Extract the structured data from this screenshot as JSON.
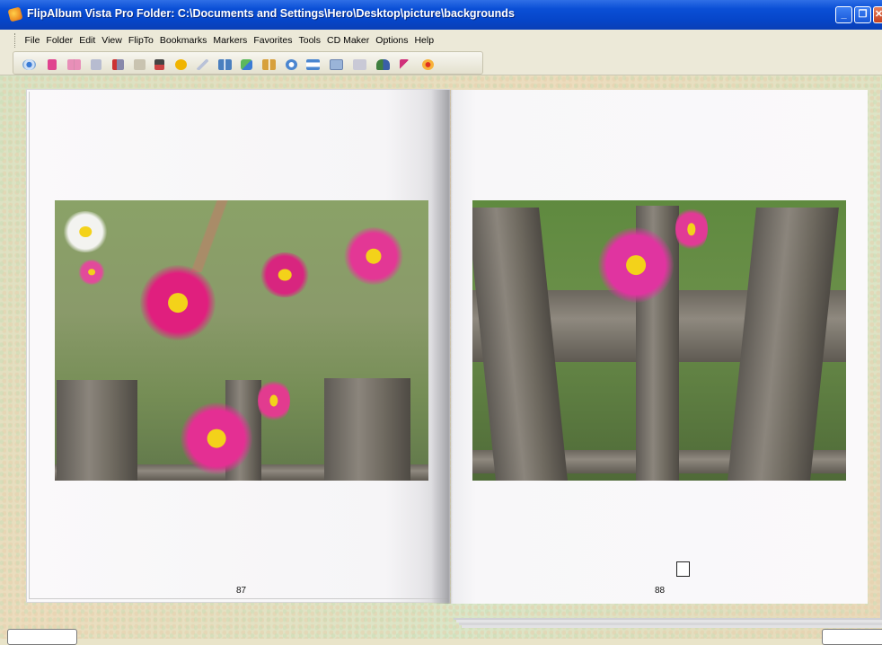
{
  "window": {
    "title": "FlipAlbum Vista Pro    Folder: C:\\Documents and Settings\\Hero\\Desktop\\picture\\backgrounds"
  },
  "menu": {
    "items": [
      "File",
      "Folder",
      "Edit",
      "View",
      "FlipTo",
      "Bookmarks",
      "Markers",
      "Favorites",
      "Tools",
      "CD Maker",
      "Options",
      "Help"
    ]
  },
  "toolbar": {
    "icons": [
      "eye-icon",
      "pink-page-icon",
      "open-book-icon",
      "single-page-icon",
      "page-arrow-icon",
      "page-list-icon",
      "save-page-icon",
      "add-circle-icon",
      "pen-icon",
      "two-pages-icon",
      "tag-icon",
      "spread-icon",
      "rotate-icon",
      "fit-width-icon",
      "frame-icon",
      "panel-icon",
      "person-tree-icon",
      "pointer-flag-icon",
      "record-icon"
    ]
  },
  "album": {
    "left_page_number": "87",
    "right_page_number": "88"
  },
  "colors": {
    "titlebar": "#0a4fd6",
    "menubar": "#ece9d8",
    "page": "#faf9fa"
  }
}
